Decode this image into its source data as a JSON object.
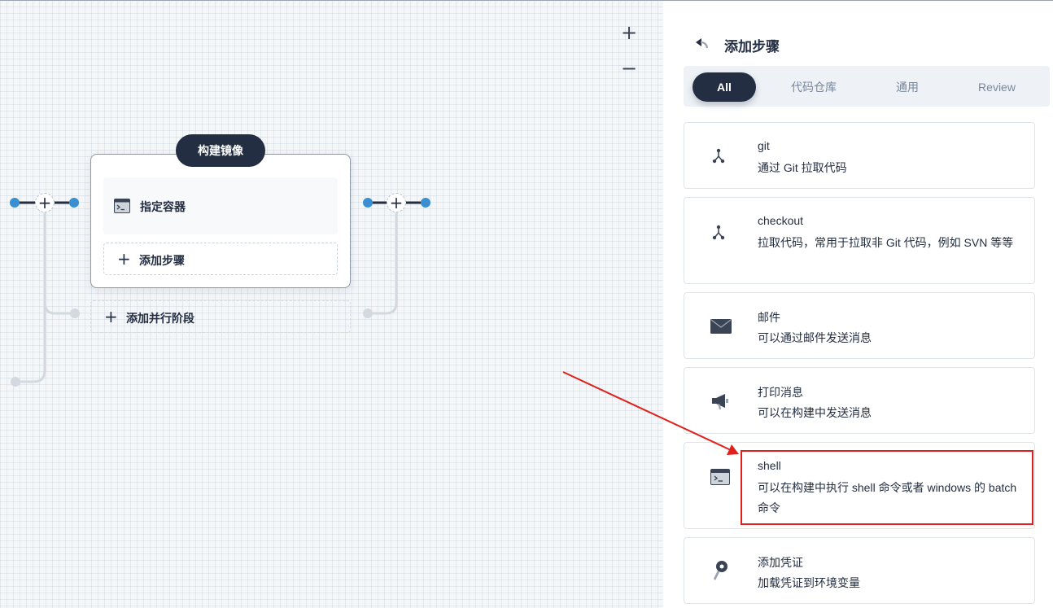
{
  "canvas": {
    "zoom_in_label": "+",
    "zoom_out_label": "−",
    "stage": {
      "title": "构建镜像",
      "steps": [
        {
          "label": "指定容器",
          "icon": "terminal-icon"
        }
      ],
      "add_step_label": "添加步骤"
    },
    "add_parallel_label": "添加并行阶段",
    "colors": {
      "node_blue": "#3a8fd1",
      "dark": "#242e42"
    }
  },
  "panel": {
    "title": "添加步骤",
    "back_icon": "back-arrow-icon",
    "tabs": [
      {
        "label": "All",
        "active": true
      },
      {
        "label": "代码仓库",
        "active": false
      },
      {
        "label": "通用",
        "active": false
      },
      {
        "label": "Review",
        "active": false
      }
    ],
    "items": [
      {
        "name": "git",
        "desc": "通过 Git 拉取代码",
        "icon": "branch-icon"
      },
      {
        "name": "checkout",
        "desc": "拉取代码，常用于拉取非 Git 代码，例如 SVN 等等",
        "icon": "branch-icon"
      },
      {
        "name": "邮件",
        "desc": "可以通过邮件发送消息",
        "icon": "mail-icon"
      },
      {
        "name": "打印消息",
        "desc": "可以在构建中发送消息",
        "icon": "megaphone-icon"
      },
      {
        "name": "shell",
        "desc": "可以在构建中执行 shell 命令或者 windows 的 batch 命令",
        "icon": "terminal-icon"
      },
      {
        "name": "添加凭证",
        "desc": "加载凭证到环境变量",
        "icon": "key-icon"
      }
    ]
  },
  "annotation": {
    "highlight_color": "#e0201b"
  }
}
